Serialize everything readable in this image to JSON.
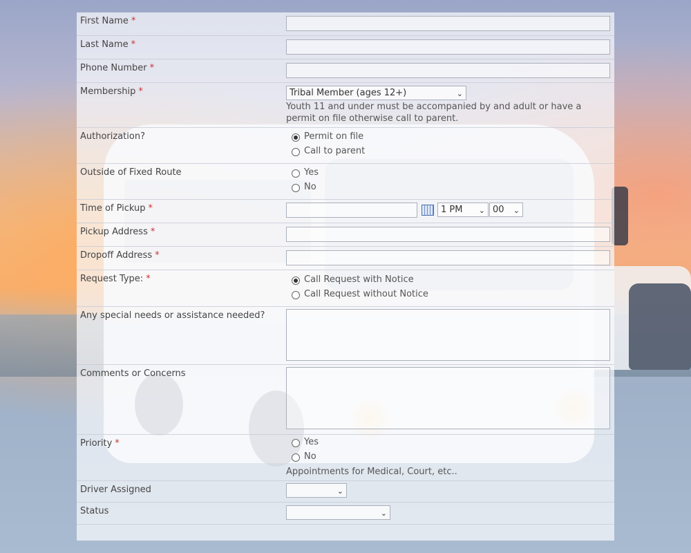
{
  "form": {
    "required_marker": "*",
    "first_name": {
      "label": "First Name",
      "value": ""
    },
    "last_name": {
      "label": "Last Name",
      "value": ""
    },
    "phone": {
      "label": "Phone Number",
      "value": ""
    },
    "membership": {
      "label": "Membership",
      "selected": "Tribal Member (ages 12+)",
      "hint_line1": "Youth 11 and under must be accompanied by and adult or have a",
      "hint_line2": "permit on file otherwise call to parent."
    },
    "authorization": {
      "label": "Authorization?",
      "options": [
        {
          "label": "Permit on file",
          "checked": true
        },
        {
          "label": "Call to parent",
          "checked": false
        }
      ]
    },
    "outside_route": {
      "label": "Outside of Fixed Route",
      "options": [
        {
          "label": "Yes",
          "checked": false
        },
        {
          "label": "No",
          "checked": false
        }
      ]
    },
    "pickup_time": {
      "label": "Time of Pickup",
      "date_value": "",
      "hour": "1 PM",
      "minute": "00",
      "calendar_icon": "calendar-icon"
    },
    "pickup_address": {
      "label": "Pickup Address",
      "value": ""
    },
    "dropoff_address": {
      "label": "Dropoff Address",
      "value": ""
    },
    "request_type": {
      "label": "Request Type:",
      "options": [
        {
          "label": "Call Request with Notice",
          "checked": true
        },
        {
          "label": "Call Request without Notice",
          "checked": false
        }
      ]
    },
    "special_needs": {
      "label": "Any special needs or assistance needed?",
      "value": ""
    },
    "comments": {
      "label": "Comments or Concerns",
      "value": ""
    },
    "priority": {
      "label": "Priority",
      "options": [
        {
          "label": "Yes",
          "checked": false
        },
        {
          "label": "No",
          "checked": false
        }
      ],
      "hint": "Appointments for Medical, Court, etc.."
    },
    "driver": {
      "label": "Driver Assigned",
      "selected": ""
    },
    "status": {
      "label": "Status",
      "selected": ""
    }
  }
}
